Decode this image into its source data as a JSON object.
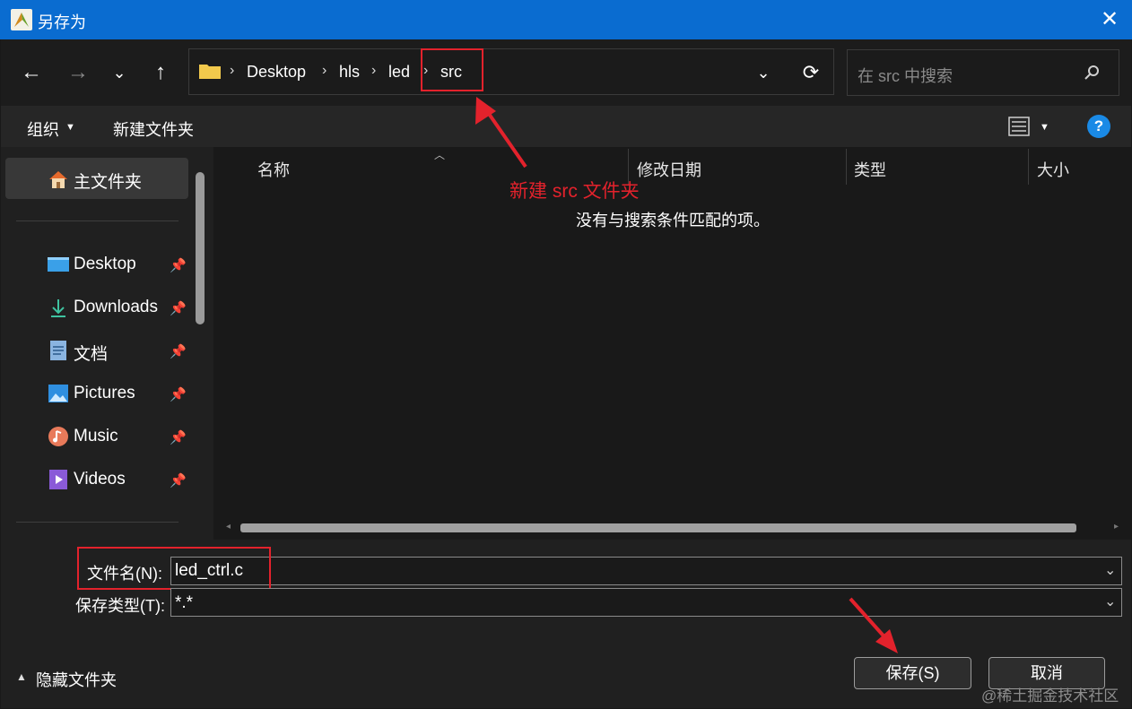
{
  "window": {
    "title": "另存为"
  },
  "nav": {
    "breadcrumb": [
      "Desktop",
      "hls",
      "led",
      "src"
    ],
    "search_placeholder": "在 src 中搜索"
  },
  "toolbar": {
    "organize": "组织",
    "new_folder": "新建文件夹"
  },
  "sidebar": {
    "home": "主文件夹",
    "items": [
      {
        "label": "Desktop",
        "icon": "desktop-icon"
      },
      {
        "label": "Downloads",
        "icon": "download-icon"
      },
      {
        "label": "文档",
        "icon": "document-icon"
      },
      {
        "label": "Pictures",
        "icon": "pictures-icon"
      },
      {
        "label": "Music",
        "icon": "music-icon"
      },
      {
        "label": "Videos",
        "icon": "videos-icon"
      }
    ]
  },
  "columns": [
    "名称",
    "修改日期",
    "类型",
    "大小"
  ],
  "empty_message": "没有与搜索条件匹配的项。",
  "filename": {
    "label": "文件名(N):",
    "value": "led_ctrl.c"
  },
  "filetype": {
    "label": "保存类型(T):",
    "value": "*.*"
  },
  "footer": {
    "hide_folders": "隐藏文件夹",
    "save": "保存(S)",
    "cancel": "取消"
  },
  "annotation": {
    "text": "新建 src 文件夹",
    "color": "#e3222c"
  },
  "watermark": "@稀土掘金技术社区",
  "colors": {
    "titlebar": "#0a6cd0",
    "background": "#191919",
    "accent_help": "#1a8ae6"
  }
}
